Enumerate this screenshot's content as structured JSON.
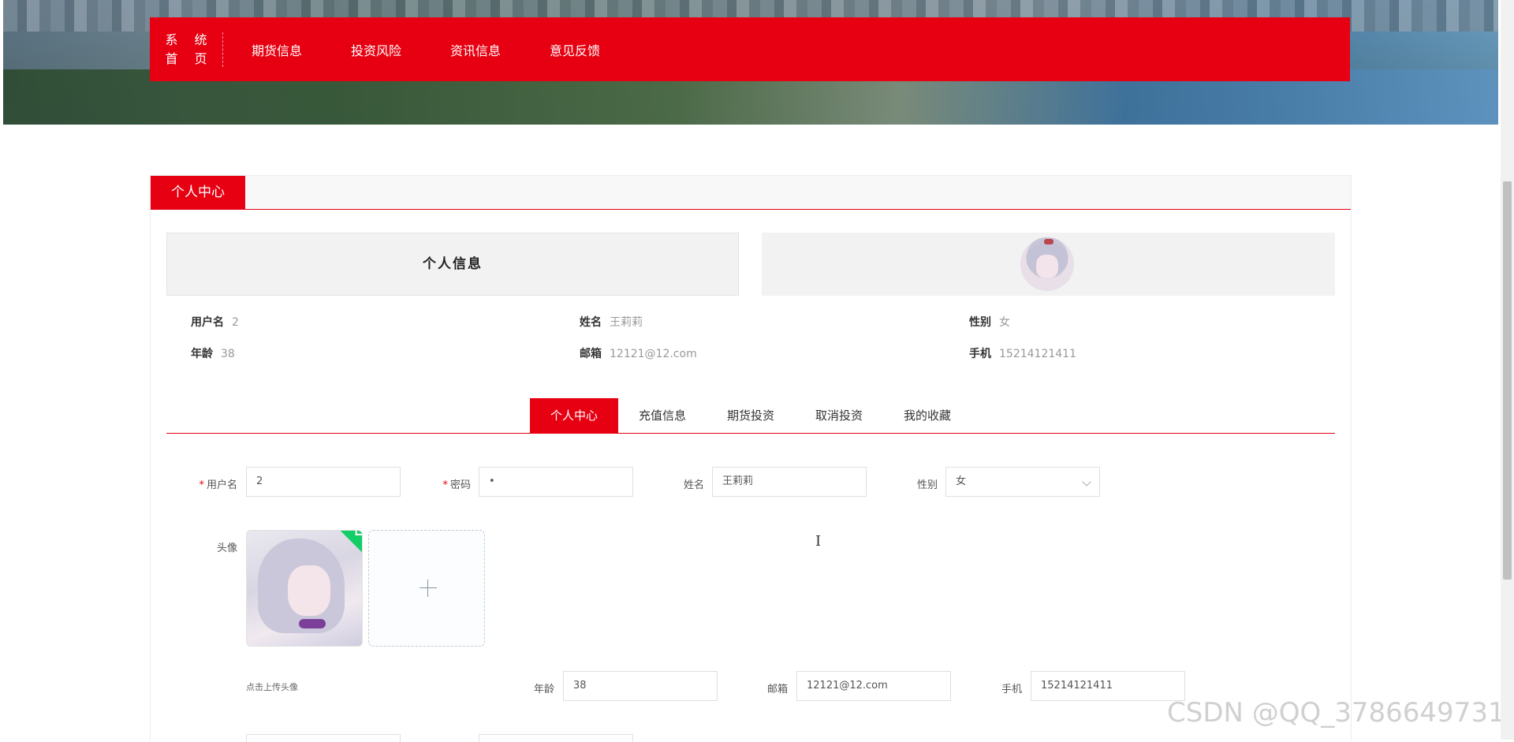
{
  "nav": {
    "home_line1": "系 统",
    "home_line2": "首 页",
    "items": [
      {
        "label": "期货信息"
      },
      {
        "label": "投资风险"
      },
      {
        "label": "资讯信息"
      },
      {
        "label": "意见反馈"
      }
    ]
  },
  "panel": {
    "tab": "个人中心",
    "info_title": "个人信息"
  },
  "profile": {
    "username": {
      "label": "用户名",
      "value": "2"
    },
    "name": {
      "label": "姓名",
      "value": "王莉莉"
    },
    "gender": {
      "label": "性别",
      "value": "女"
    },
    "age": {
      "label": "年龄",
      "value": "38"
    },
    "email": {
      "label": "邮箱",
      "value": "12121@12.com"
    },
    "phone": {
      "label": "手机",
      "value": "15214121411"
    }
  },
  "tabs": [
    {
      "label": "个人中心",
      "active": true
    },
    {
      "label": "充值信息",
      "active": false
    },
    {
      "label": "期货投资",
      "active": false
    },
    {
      "label": "取消投资",
      "active": false
    },
    {
      "label": "我的收藏",
      "active": false
    }
  ],
  "form": {
    "username": {
      "label": "用户名",
      "value": "2"
    },
    "password": {
      "label": "密码",
      "value": "•"
    },
    "name": {
      "label": "姓名",
      "value": "王莉莉"
    },
    "gender": {
      "label": "性别",
      "value": "女"
    },
    "avatar": {
      "label": "头像",
      "hint": "点击上传头像"
    },
    "age": {
      "label": "年龄",
      "value": "38"
    },
    "email": {
      "label": "邮箱",
      "value": "12121@12.com"
    },
    "phone": {
      "label": "手机",
      "value": "15214121411"
    }
  },
  "watermark": "CSDN @QQ_3786649731",
  "colors": {
    "brand": "#e60012"
  }
}
